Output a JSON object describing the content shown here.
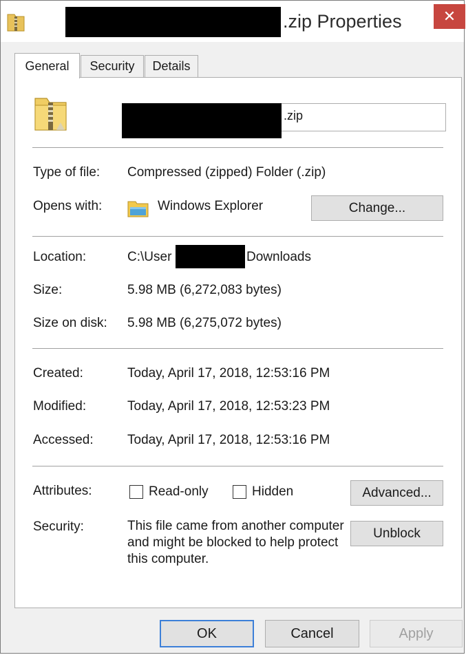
{
  "window": {
    "title_suffix": ".zip Properties",
    "close_glyph": "✕"
  },
  "tabs": [
    {
      "label": "General",
      "active": true
    },
    {
      "label": "Security",
      "active": false
    },
    {
      "label": "Details",
      "active": false
    }
  ],
  "general": {
    "file_name_suffix": ".zip",
    "type_label": "Type of file:",
    "type_value": "Compressed (zipped) Folder (.zip)",
    "opens_label": "Opens with:",
    "opens_value": "Windows Explorer",
    "change_button": "Change...",
    "location_label": "Location:",
    "location_prefix": "C:\\User",
    "location_suffix": "Downloads",
    "size_label": "Size:",
    "size_value": "5.98 MB (6,272,083 bytes)",
    "size_on_disk_label": "Size on disk:",
    "size_on_disk_value": "5.98 MB (6,275,072 bytes)",
    "created_label": "Created:",
    "created_value": "Today, April 17, 2018, 12:53:16 PM",
    "modified_label": "Modified:",
    "modified_value": "Today, April 17, 2018, 12:53:23 PM",
    "accessed_label": "Accessed:",
    "accessed_value": "Today, April 17, 2018, 12:53:16 PM",
    "attributes_label": "Attributes:",
    "readonly_label": "Read-only",
    "readonly_checked": false,
    "hidden_label": "Hidden",
    "hidden_checked": false,
    "advanced_button": "Advanced...",
    "security_label": "Security:",
    "security_text": "This file came from another computer and might be blocked to help protect this computer.",
    "unblock_button": "Unblock"
  },
  "footer": {
    "ok": "OK",
    "cancel": "Cancel",
    "apply": "Apply",
    "apply_enabled": false
  },
  "icons": {
    "title_icon": "zip-folder-icon",
    "file_icon": "zip-folder-icon",
    "opens_with_icon": "windows-explorer-icon",
    "close_icon": "close-icon"
  }
}
